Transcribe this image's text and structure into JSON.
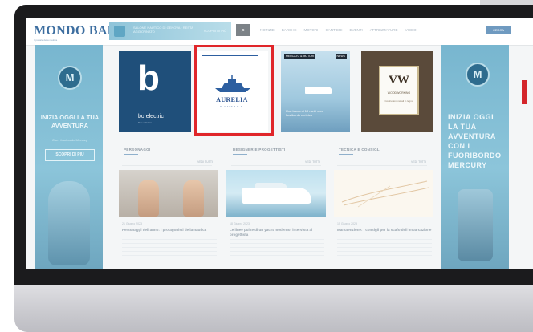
{
  "site": {
    "logo": "MONDO BARCA",
    "logo_sub": "Il portale della nautica",
    "banner_text": "SALONE NAUTICO DI GENOVA · RESTA AGGIORNATO",
    "banner_action": "SCOPRI DI PIÙ",
    "search_symbol": "⌕",
    "nav": [
      "NOTIZIE",
      "BARCHE",
      "MOTORI",
      "CANTIERI",
      "EVENTI",
      "ATTREZZATURE",
      "VIDEO"
    ],
    "nav_button": "CERCA"
  },
  "left_banner": {
    "logo_symbol": "M",
    "headline": "INIZIA OGGI LA TUA AVVENTURA",
    "subtext": "Con i fuoribordo Mercury",
    "button": "SCOPRI DI PIÙ"
  },
  "right_banner": {
    "logo_symbol": "M",
    "headline": "INIZIA OGGI LA TUA AVVENTURA CON I FUORIBORDO MERCURY"
  },
  "tiles": [
    {
      "brand": "bo electric",
      "symbol": "b",
      "sub": "blue solution"
    },
    {
      "brand": "AURELIA",
      "sub": "NAUTICA"
    },
    {
      "tag": "MERCATO & MOTORI",
      "tag2": "NEWS",
      "caption": "Una barca di 10 metri con fuoribordo elettrico"
    },
    {
      "brand": "VW",
      "sub": "WOODWORKING",
      "sub2": "Costruzioni navali in legno"
    }
  ],
  "sections": [
    {
      "title": "PERSONAGGI",
      "more": "VEDI TUTTI",
      "meta": "21 Giugno 2023",
      "headline": "Personaggi dell'anno: i protagonisti della nautica"
    },
    {
      "title": "DESIGNER E PROGETTISTI",
      "more": "VEDI TUTTI",
      "meta": "18 Giugno 2023",
      "headline": "Le linee pulite di un yacht moderno: intervista al progettista"
    },
    {
      "title": "TECNICA E CONSIGLI",
      "more": "VEDI TUTTI",
      "meta": "15 Giugno 2023",
      "headline": "Manutenzione: i consigli per la scafo dell'imbarcazione"
    }
  ],
  "colors": {
    "brand_blue": "#3d6ea0",
    "selection_red": "#e0262a",
    "banner_blue": "#78b6cf"
  }
}
